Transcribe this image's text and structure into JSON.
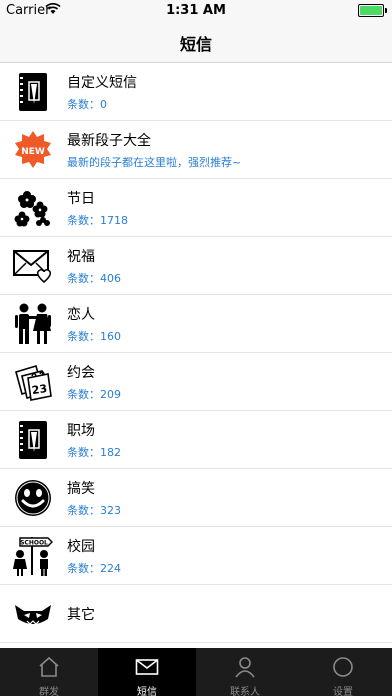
{
  "status": {
    "carrier": "Carrier",
    "time": "1:31 AM"
  },
  "nav": {
    "title": "短信"
  },
  "categories": [
    {
      "title": "自定义短信",
      "sub": "条数：0",
      "icon": "notebook-pen-icon"
    },
    {
      "title": "最新段子大全",
      "sub": "最新的段子都在这里啦，强烈推荐~",
      "icon": "new-badge-icon",
      "badge": "NEW"
    },
    {
      "title": "节日",
      "sub": "条数：1718",
      "icon": "flowers-icon"
    },
    {
      "title": "祝福",
      "sub": "条数：406",
      "icon": "envelope-heart-icon"
    },
    {
      "title": "恋人",
      "sub": "条数：160",
      "icon": "couple-icon"
    },
    {
      "title": "约会",
      "sub": "条数：209",
      "icon": "calendar-icon",
      "day": "23"
    },
    {
      "title": "职场",
      "sub": "条数：182",
      "icon": "notebook-pen-icon"
    },
    {
      "title": "搞笑",
      "sub": "条数：323",
      "icon": "smiley-icon"
    },
    {
      "title": "校园",
      "sub": "条数：224",
      "icon": "school-kids-icon",
      "sign": "SCHOOL"
    },
    {
      "title": "其它",
      "sub": "",
      "icon": "monster-icon"
    }
  ],
  "tabs": [
    {
      "label": "群发",
      "icon": "house-icon"
    },
    {
      "label": "短信",
      "icon": "envelope-icon",
      "active": true
    },
    {
      "label": "联系人",
      "icon": "person-icon"
    },
    {
      "label": "设置",
      "icon": "circle-icon"
    }
  ],
  "colors": {
    "accent": "#2a7fd4",
    "tab_bar": "#1c1c1c",
    "battery": "#4cd964",
    "badge": "#f05a28"
  }
}
